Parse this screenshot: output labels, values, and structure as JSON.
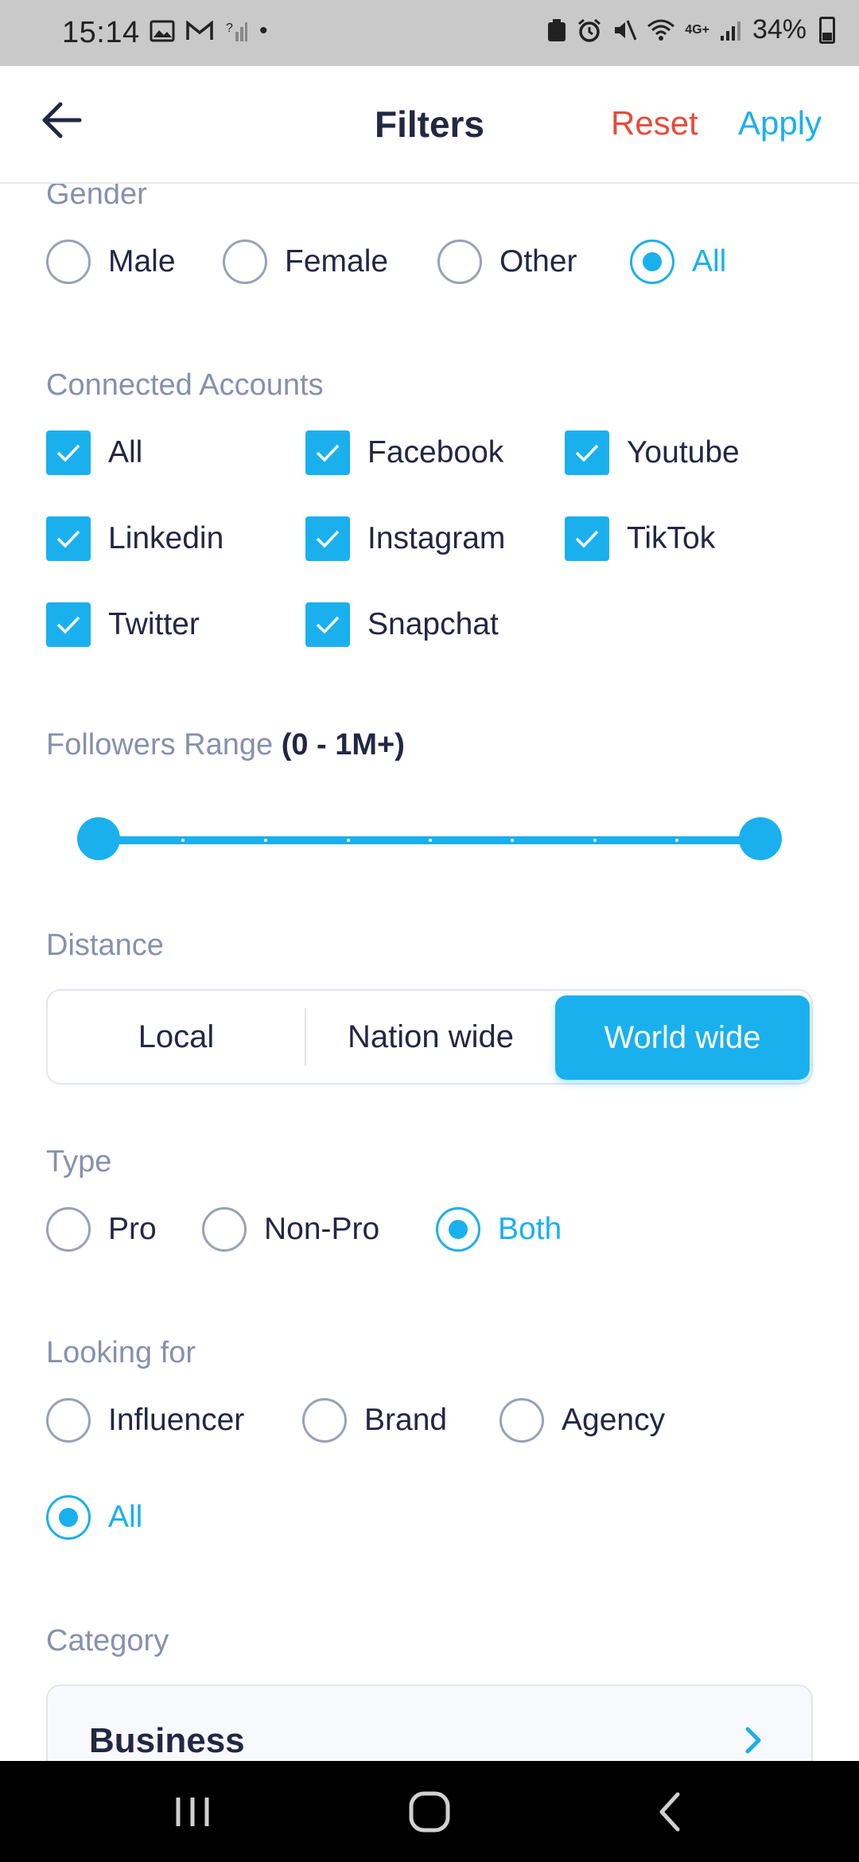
{
  "status_bar": {
    "time": "15:14",
    "battery": "34%",
    "network": "4G+"
  },
  "header": {
    "title": "Filters",
    "reset_label": "Reset",
    "apply_label": "Apply",
    "reset_color": "#e84a3b",
    "accent_color": "#1ab0ee"
  },
  "gender": {
    "label": "Gender",
    "options": [
      "Male",
      "Female",
      "Other",
      "All"
    ],
    "selected": "All"
  },
  "connected_accounts": {
    "label": "Connected Accounts",
    "options": [
      "All",
      "Facebook",
      "Youtube",
      "Linkedin",
      "Instagram",
      "TikTok",
      "Twitter",
      "Snapchat"
    ],
    "checked": [
      true,
      true,
      true,
      true,
      true,
      true,
      true,
      true
    ]
  },
  "followers_range": {
    "label": "Followers Range",
    "value_text": "(0 - 1M+)",
    "min_fraction": 0,
    "max_fraction": 1
  },
  "distance": {
    "label": "Distance",
    "options": [
      "Local",
      "Nation wide",
      "World wide"
    ],
    "selected": "World wide"
  },
  "type": {
    "label": "Type",
    "options": [
      "Pro",
      "Non-Pro",
      "Both"
    ],
    "selected": "Both"
  },
  "looking_for": {
    "label": "Looking for",
    "options": [
      "Influencer",
      "Brand",
      "Agency",
      "All"
    ],
    "selected": "All"
  },
  "category": {
    "label": "Category",
    "value": "Business"
  }
}
